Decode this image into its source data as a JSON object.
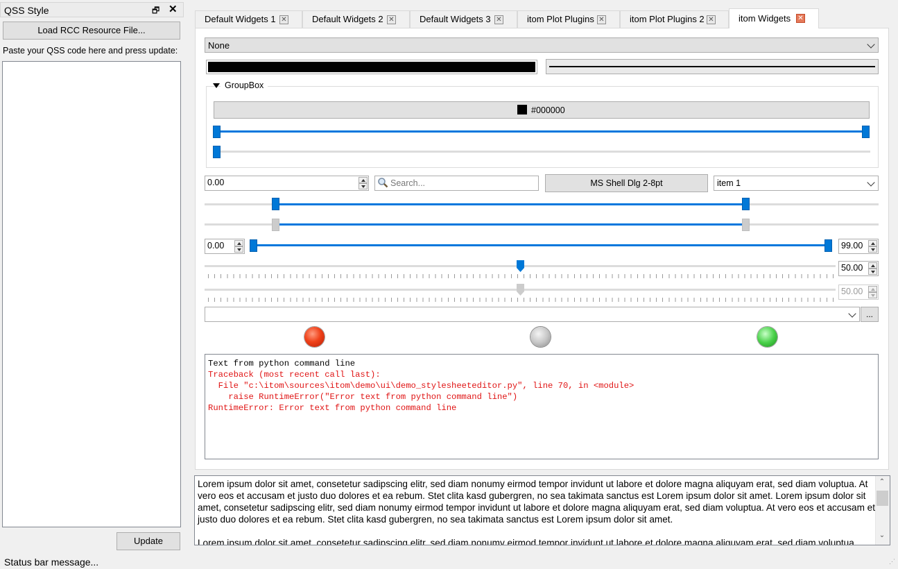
{
  "dock": {
    "title": "QSS Style",
    "float_glyph": "🗗",
    "close_glyph": "✕",
    "load_button": "Load RCC Resource File...",
    "paste_label": "Paste your QSS code here and press update:",
    "qss_text": "",
    "update_button": "Update"
  },
  "status_bar": {
    "message": "Status bar message..."
  },
  "tabs": [
    {
      "label": "Default Widgets 1",
      "active": false
    },
    {
      "label": "Default Widgets 2",
      "active": false
    },
    {
      "label": "Default Widgets 3",
      "active": false
    },
    {
      "label": "itom Plot Plugins",
      "active": false
    },
    {
      "label": "itom Plot Plugins 2",
      "active": false
    },
    {
      "label": "itom Widgets",
      "active": true
    }
  ],
  "tab_close_glyph": "✕",
  "widgets": {
    "style_combo": {
      "value": "None"
    },
    "color_bar": {
      "color": "#000000"
    },
    "line_width_box": {
      "color": "#000000"
    },
    "groupbox": {
      "title": "GroupBox"
    },
    "color_picker": {
      "value": "#000000",
      "swatch_color": "#000000"
    },
    "range_slider_1": {
      "min": 0,
      "max": 1
    },
    "spinbox_main": {
      "value": "0.00"
    },
    "search": {
      "placeholder": "Search...",
      "icon": "magnifier-icon"
    },
    "font_button": {
      "label": "MS Shell Dlg 2-8pt"
    },
    "item_combo": {
      "value": "item 1"
    },
    "range_slider_2": {
      "min": 0.11,
      "max": 0.89
    },
    "range_slider_2_disabled": {
      "min": 0.11,
      "max": 0.89
    },
    "double_range": {
      "min_value": "0.00",
      "max_value": "99.00"
    },
    "slider_enabled": {
      "value": "50.00"
    },
    "slider_disabled": {
      "value": "50.00"
    },
    "path_combo": {
      "value": "",
      "browse_label": "..."
    },
    "leds": [
      {
        "name": "red",
        "color": "#e8401c"
      },
      {
        "name": "grey",
        "color": "#bdbdbd"
      },
      {
        "name": "green",
        "color": "#3cc93c"
      }
    ],
    "console": {
      "lines": [
        {
          "text": "Text from python command line",
          "color": "#000000"
        },
        {
          "text": "Traceback (most recent call last):",
          "color": "#e01414"
        },
        {
          "text": "  File \"c:\\itom\\sources\\itom\\demo\\ui\\demo_stylesheeteditor.py\", line 70, in <module>",
          "color": "#e01414"
        },
        {
          "text": "    raise RuntimeError(\"Error text from python command line\")",
          "color": "#e01414"
        },
        {
          "text": "RuntimeError: Error text from python command line",
          "color": "#e01414"
        }
      ]
    }
  },
  "lorem": {
    "paragraph_1": "Lorem ipsum dolor sit amet, consetetur sadipscing elitr, sed diam nonumy eirmod tempor invidunt ut labore et dolore magna aliquyam erat, sed diam voluptua. At vero eos et accusam et justo duo dolores et ea rebum. Stet clita kasd gubergren, no sea takimata sanctus est Lorem ipsum dolor sit amet. Lorem ipsum dolor sit amet, consetetur sadipscing elitr, sed diam nonumy eirmod tempor invidunt ut labore et dolore magna aliquyam erat, sed diam voluptua. At vero eos et accusam et justo duo dolores et ea rebum. Stet clita kasd gubergren, no sea takimata sanctus est Lorem ipsum dolor sit amet.",
    "paragraph_2": "Lorem ipsum dolor sit amet, consetetur sadipscing elitr, sed diam nonumy eirmod tempor invidunt ut labore et dolore magna aliquyam erat, sed diam voluptua.",
    "scroll_up_glyph": "⌃",
    "scroll_down_glyph": "⌄"
  }
}
